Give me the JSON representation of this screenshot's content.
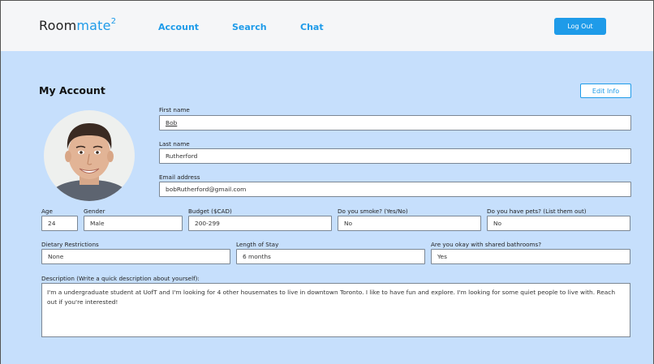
{
  "header": {
    "logo_text_1": "Room",
    "logo_text_2": "mate",
    "logo_sup": "2",
    "nav": [
      "Account",
      "Search",
      "Chat"
    ],
    "logout_label": "Log Out"
  },
  "account": {
    "title": "My Account",
    "edit_label": "Edit Info",
    "fields": {
      "first_name": {
        "label": "First name",
        "value": "Bob"
      },
      "last_name": {
        "label": "Last name",
        "value": "Rutherford"
      },
      "email": {
        "label": "Email address",
        "value": "bobRutherford@gmail.com"
      },
      "age": {
        "label": "Age",
        "value": "24"
      },
      "gender": {
        "label": "Gender",
        "value": "Male"
      },
      "budget": {
        "label": "Budget ($CAD)",
        "value": "200-299"
      },
      "smoke": {
        "label": "Do you smoke? (Yes/No)",
        "value": "No"
      },
      "pets": {
        "label": "Do you have pets? (List them out)",
        "value": "No"
      },
      "dietary": {
        "label": "Dietary Restrictions",
        "value": "None"
      },
      "stay": {
        "label": "Length of Stay",
        "value": "6 months"
      },
      "bathrooms": {
        "label": "Are you okay with shared bathrooms?",
        "value": "Yes"
      },
      "description": {
        "label": "Description (Write a quick description about yourself):",
        "value": "I'm a undergraduate student at UofT and I'm looking for 4 other housemates to live in downtown Toronto. I like to have fun and explore. I'm looking for some quiet people to live with. Reach out if you're interested!"
      }
    }
  }
}
